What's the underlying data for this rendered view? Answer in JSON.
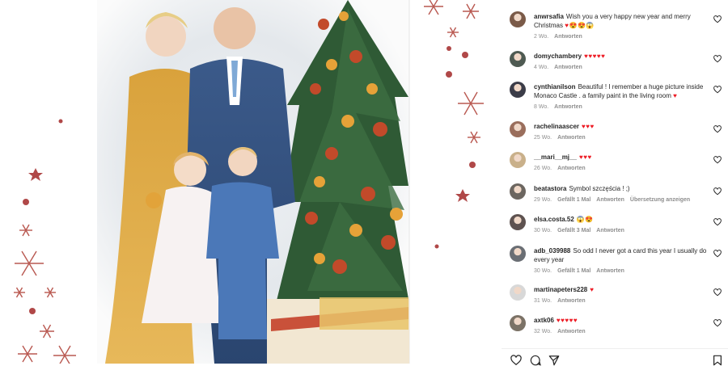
{
  "comments": [
    {
      "username": "anwrsafia",
      "text": "Wish you a very happy new year and merry Christmas",
      "emoji": "♥😍😍😱",
      "meta": [
        "2 Wo.",
        "Antworten"
      ],
      "avatar_color": "#7a5a48"
    },
    {
      "username": "domychambery",
      "text": "",
      "emoji": "♥♥♥♥♥",
      "meta": [
        "4 Wo.",
        "Antworten"
      ],
      "avatar_color": "#4e5a52"
    },
    {
      "username": "cynthianilson",
      "text": "Beautiful ! I remember a huge picture inside Monaco Castle . a family paint in the living room",
      "emoji": "♥",
      "meta": [
        "8 Wo.",
        "Antworten"
      ],
      "avatar_color": "#3b3c48"
    },
    {
      "username": "rachelinaascer",
      "text": "",
      "emoji": "♥♥♥",
      "meta": [
        "25 Wo.",
        "Antworten"
      ],
      "avatar_color": "#9a6e5c"
    },
    {
      "username": "__mari__mj__",
      "text": "",
      "emoji": "♥♥♥",
      "meta": [
        "26 Wo.",
        "Antworten"
      ],
      "avatar_color": "#c9b08a"
    },
    {
      "username": "beatastora",
      "text": "Symbol szczęścia ! ;)",
      "emoji": "",
      "meta": [
        "29 Wo.",
        "Gefällt 1 Mal",
        "Antworten",
        "Übersetzung anzeigen"
      ],
      "avatar_color": "#6c6660"
    },
    {
      "username": "elsa.costa.52",
      "text": "",
      "emoji": "😱😍",
      "meta": [
        "30 Wo.",
        "Gefällt 3 Mal",
        "Antworten"
      ],
      "avatar_color": "#5e5250"
    },
    {
      "username": "adb_039988",
      "text": "So odd I never got a card this year I usually do every year",
      "emoji": "",
      "meta": [
        "30 Wo.",
        "Gefällt 1 Mal",
        "Antworten"
      ],
      "avatar_color": "#6a6e74"
    },
    {
      "username": "martinapeters228",
      "text": "",
      "emoji": "♥",
      "meta": [
        "31 Wo.",
        "Antworten"
      ],
      "avatar_color": "#d8d8d8"
    },
    {
      "username": "axtk06",
      "text": "",
      "emoji": "♥♥♥♥♥",
      "meta": [
        "32 Wo.",
        "Antworten"
      ],
      "avatar_color": "#7b7266"
    }
  ],
  "actions": {
    "like": "heart-outline",
    "comment": "speech-bubble",
    "share": "paper-plane",
    "save": "bookmark"
  },
  "colors": {
    "accent_red": "#ed1b24",
    "meta_gray": "#8e8e8e",
    "text": "#262626"
  }
}
